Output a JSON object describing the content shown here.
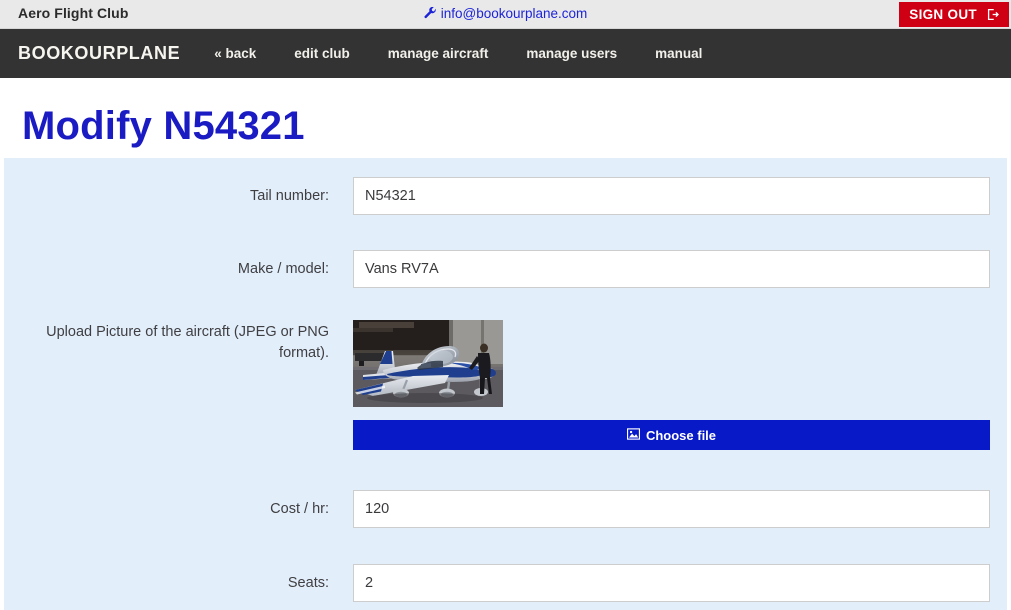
{
  "topbar": {
    "club_name": "Aero Flight Club",
    "contact_email": "info@bookourplane.com",
    "contact_icon": "wrench-icon",
    "signout_label": "SIGN OUT",
    "signout_icon": "sign-out-icon",
    "signout_color": "#d00014",
    "background": "#e9e9e9",
    "link_color": "#1d24d8"
  },
  "nav": {
    "logo": "BOOKOURPLANE",
    "background": "#333333",
    "items": [
      {
        "label": "« back"
      },
      {
        "label": "edit club"
      },
      {
        "label": "manage aircraft"
      },
      {
        "label": "manage users"
      },
      {
        "label": "manual"
      }
    ]
  },
  "page": {
    "title": "Modify N54321",
    "title_color": "#1b1bc4",
    "panel_background": "#e3eefb"
  },
  "form": {
    "tail_number": {
      "label": "Tail number:",
      "value": "N54321",
      "placeholder": ""
    },
    "make_model": {
      "label": "Make / model:",
      "value": "Vans RV7A",
      "placeholder": ""
    },
    "upload": {
      "label": "Upload Picture of the aircraft (JPEG or PNG format).",
      "thumbnail_alt": "aircraft-photo",
      "choose_file_label": "Choose file",
      "choose_file_icon": "picture-icon",
      "choose_file_color": "#0819c8"
    },
    "cost_per_hour": {
      "label": "Cost / hr:",
      "value": "120",
      "placeholder": ""
    },
    "seats": {
      "label": "Seats:",
      "value": "2",
      "placeholder": ""
    }
  }
}
